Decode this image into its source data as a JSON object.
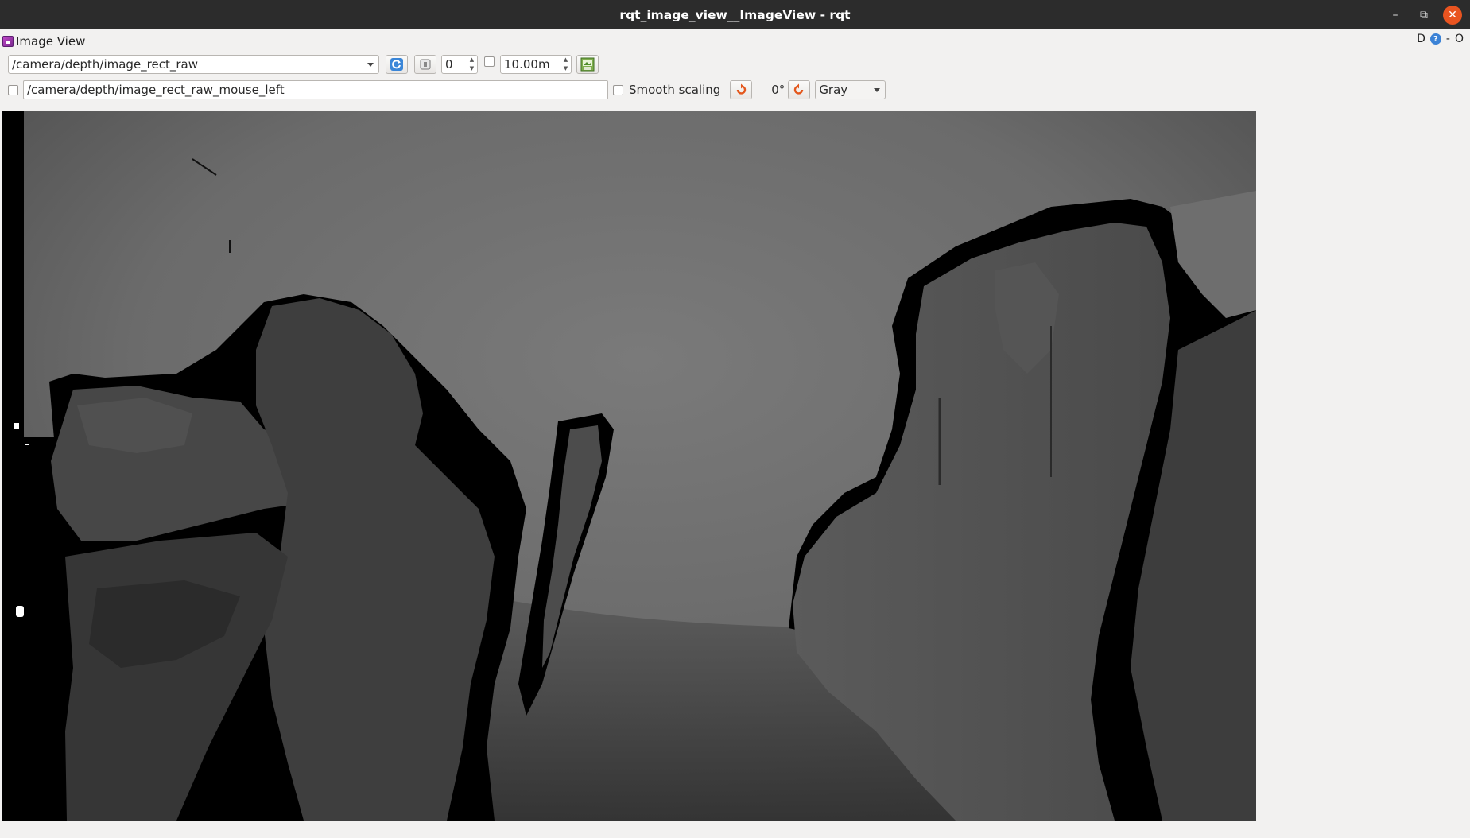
{
  "window": {
    "title": "rqt_image_view__ImageView - rqt",
    "minimize_icon": "minimize-icon",
    "maximize_icon": "restore-icon",
    "close_icon": "close-icon"
  },
  "plugin": {
    "title": "Image View",
    "right_d": "D",
    "right_dash": "-",
    "right_o": "O"
  },
  "toolbar": {
    "topic": "/camera/depth/image_rect_raw",
    "spin_value": "0",
    "max_range": "10.00m",
    "mouse_topic": "/camera/depth/image_rect_raw_mouse_left",
    "smooth_scaling_label": "Smooth scaling",
    "rotation": "0°",
    "colormap": "Gray"
  },
  "image": {
    "kind": "depth grayscale",
    "colors": {
      "background": "#000000",
      "far": "#6e6e6e",
      "mid": "#525252",
      "near": "#2e2e2e"
    }
  }
}
